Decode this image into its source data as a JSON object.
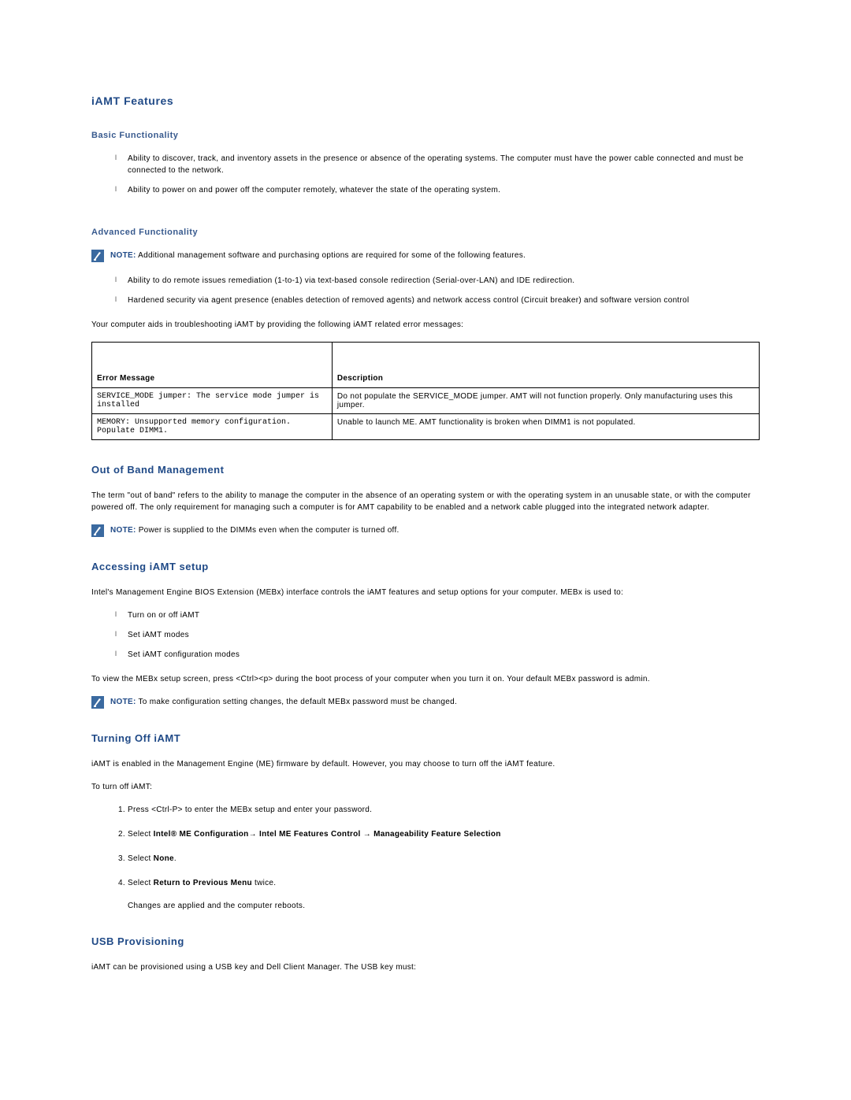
{
  "headings": {
    "iamt_features": "iAMT Features",
    "basic_func": "Basic Functionality",
    "advanced_func": "Advanced Functionality",
    "oob": "Out of Band Management",
    "accessing": "Accessing iAMT setup",
    "turning_off": "Turning Off iAMT",
    "usb_prov": "USB Provisioning"
  },
  "basic_list": [
    "Ability to discover, track, and inventory assets in the presence or absence of the operating systems. The computer must have the power cable connected and must be connected to the network.",
    "Ability to power on and power off the computer remotely, whatever the state of the operating system."
  ],
  "adv_note": {
    "label": "NOTE:",
    "text": " Additional management software and purchasing options are required for some of the following features."
  },
  "adv_list": [
    "Ability to do remote issues remediation (1-to-1) via text-based console redirection (Serial-over-LAN) and IDE redirection.",
    "Hardened security via agent presence (enables detection of removed agents) and network access control (Circuit breaker) and software version control"
  ],
  "troubleshoot_intro": "Your computer aids in troubleshooting iAMT by providing the following iAMT related error messages:",
  "table": {
    "head_err": "Error Message",
    "head_desc": "Description",
    "rows": [
      {
        "err": "SERVICE_MODE jumper: The service mode jumper is installed",
        "desc": "Do not populate the SERVICE_MODE jumper. AMT will not function properly. Only manufacturing uses this jumper."
      },
      {
        "err": "MEMORY: Unsupported memory configuration. Populate DIMM1.",
        "desc": "Unable to launch ME. AMT functionality is broken when DIMM1 is not populated."
      }
    ]
  },
  "oob_text": "The term \"out of band\" refers to the ability to manage the computer in the absence of an operating system or with the operating system in an unusable state, or with the computer powered off. The only requirement for managing such a computer is for AMT capability to be enabled and a network cable plugged into the integrated network adapter.",
  "oob_note": {
    "label": "NOTE:",
    "text": " Power is supplied to the DIMMs even when the computer is turned off."
  },
  "access_intro": "Intel's Management Engine BIOS Extension (MEBx) interface controls the iAMT features and setup options for your computer. MEBx is used to:",
  "access_list": [
    "Turn on or off iAMT",
    "Set iAMT modes",
    "Set iAMT configuration modes"
  ],
  "access_outro": "To view the MEBx setup screen, press <Ctrl><p> during the boot process of your computer when you turn it on. Your default MEBx password is admin.",
  "access_note": {
    "label": "NOTE:",
    "text": " To make configuration setting changes, the default MEBx password must be changed."
  },
  "turnoff_intro": "iAMT is enabled in the Management Engine (ME) firmware by default. However, you may choose to turn off the iAMT feature.",
  "turnoff_lead": "To turn off iAMT:",
  "turnoff_steps": {
    "s1": "Press <Ctrl-P> to enter the MEBx setup and enter your password.",
    "s2_pre": "Select ",
    "s2_b1": "Intel® ME Configuration",
    "s2_arrow1": "→ ",
    "s2_b2": "Intel ME Features Control",
    "s2_arrow2": " → ",
    "s2_b3": "Manageability Feature Selection",
    "s3_pre": "Select ",
    "s3_b": "None",
    "s3_post": ".",
    "s4_pre": "Select ",
    "s4_b": "Return to Previous Menu",
    "s4_post": " twice.",
    "s4_sub": "Changes are applied and the computer reboots."
  },
  "usb_text": "iAMT can be provisioned using a USB key and Dell Client Manager. The USB key must:"
}
